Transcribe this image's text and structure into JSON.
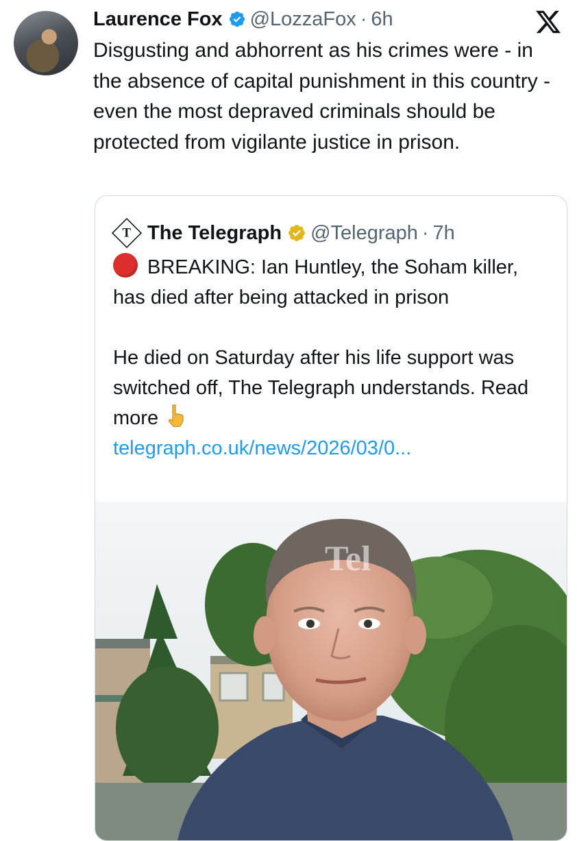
{
  "author": {
    "name": "Laurence Fox",
    "handle": "@LozzaFox",
    "separator": "·",
    "time": "6h",
    "text": "Disgusting and abhorrent as his crimes were - in the absence of capital punishment in this country - even the most depraved criminals should be protected from vigilante justice in prison."
  },
  "quoted": {
    "name": "The Telegraph",
    "handle": "@Telegraph",
    "separator": "·",
    "time": "7h",
    "breaking": "BREAKING: Ian Huntley, the Soham killer, has died after being attacked in prison",
    "body": "He died on Saturday after his life support was switched off, The Telegraph understands. Read more",
    "link": "telegraph.co.uk/news/2026/03/0...",
    "watermark": "Tel"
  },
  "colors": {
    "verified_blue": "#1d9bf0",
    "verified_gold": "#e2b719",
    "link": "#1d9bf0",
    "breaking_dot": "#dd2e2e"
  },
  "icons": [
    "verified-badge-icon",
    "x-logo-icon",
    "telegraph-logo-icon",
    "gold-verified-badge-icon",
    "red-circle-icon",
    "pointing-down-icon"
  ]
}
